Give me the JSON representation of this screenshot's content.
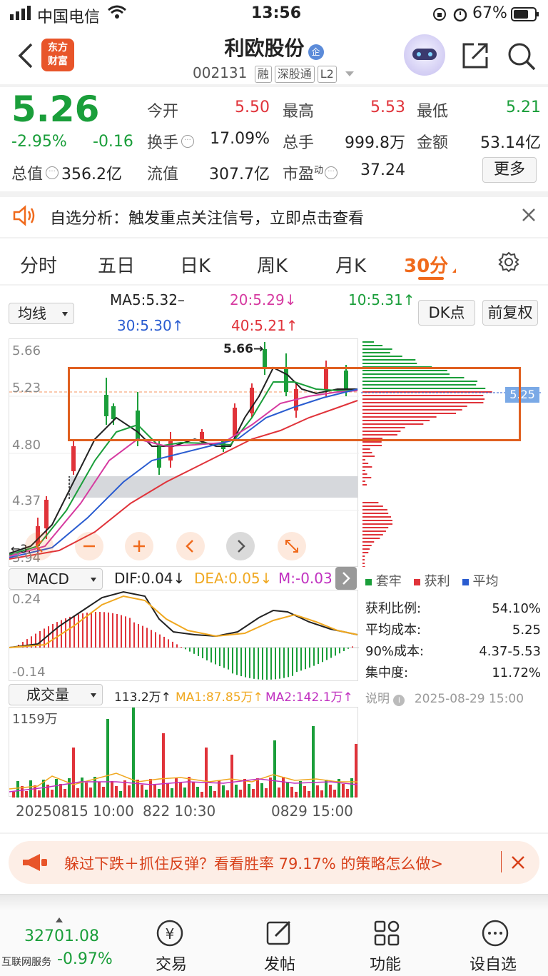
{
  "status_bar": {
    "carrier": "中国电信",
    "time": "13:56",
    "battery": "67%"
  },
  "header": {
    "logo_text": "东方\n财富",
    "title": "利欧股份",
    "title_badge": "企",
    "code": "002131",
    "tags": [
      "融",
      "深股通",
      "L2"
    ]
  },
  "quote": {
    "price": "5.26",
    "change_pct": "-2.95%",
    "change_amt": "-0.16",
    "total_value_label": "总值",
    "total_value": "356.2亿",
    "open_label": "今开",
    "open": "5.50",
    "high_label": "最高",
    "high": "5.53",
    "low_label": "最低",
    "low": "5.21",
    "turnover_label": "换手",
    "turnover": "17.09%",
    "volume_label": "总手",
    "volume": "999.8万",
    "amount_label": "金额",
    "amount": "53.14亿",
    "float_label": "流值",
    "float_value": "307.7亿",
    "pe_label": "市盈",
    "pe_sup": "动",
    "pe": "37.24",
    "more_label": "更多"
  },
  "alert_banner": {
    "text": "自选分析：触发重点关注信号，立即点击查看"
  },
  "period_tabs": [
    {
      "label": "分时",
      "active": false
    },
    {
      "label": "五日",
      "active": false
    },
    {
      "label": "日K",
      "active": false
    },
    {
      "label": "周K",
      "active": false
    },
    {
      "label": "月K",
      "active": false
    },
    {
      "label": "30分",
      "active": true
    }
  ],
  "ma_controls": {
    "selector": "均线",
    "ma5": "MA5:5.32–",
    "ma20": "20:5.29↓",
    "ma10": "10:5.31↑",
    "ma30": "30:5.30↑",
    "ma40": "40:5.21↑",
    "dk_button": "DK点",
    "adjust_button": "前复权"
  },
  "kline": {
    "y_labels": [
      "5.66",
      "5.23",
      "4.80",
      "4.37",
      "3.94"
    ],
    "max_marker": "5.66→",
    "min_marker": "←3.",
    "current_tag": "5.25"
  },
  "macd": {
    "selector": "MACD",
    "dif": "DIF:0.04↓",
    "dea": "DEA:0.05↓",
    "m": "M:-0.03",
    "y_top": "0.24",
    "y_bottom": "-0.14"
  },
  "volume": {
    "selector": "成交量",
    "vol": "113.2万↑",
    "ma1": "MA1:87.85万↑",
    "ma2": "MA2:142.1万↑",
    "y_top": "1159万",
    "x_labels": [
      "20250815 10:00",
      "822 10:30",
      "0829 15:00"
    ]
  },
  "chips": {
    "legend": [
      "套牢",
      "获利",
      "平均"
    ],
    "rows": [
      {
        "label": "获利比例:",
        "value": "54.10%"
      },
      {
        "label": "平均成本:",
        "value": "5.25"
      },
      {
        "label": "90%成本:",
        "value": "4.37-5.53"
      },
      {
        "label": "集中度:",
        "value": "11.72%"
      }
    ],
    "note_label": "说明",
    "note_time": "2025-08-29 15:00"
  },
  "promo": {
    "text": "躲过下跌＋抓住反弹？看看胜率 79.17% 的策略怎么做>"
  },
  "bottom_index": {
    "value": "32701.08",
    "label": "互联网服务",
    "change": "-0.97%"
  },
  "bottom_nav": [
    {
      "label": "交易",
      "icon": "trade-icon"
    },
    {
      "label": "发帖",
      "icon": "post-icon"
    },
    {
      "label": "功能",
      "icon": "function-icon"
    },
    {
      "label": "设自选",
      "icon": "add-watch-icon"
    }
  ],
  "colors": {
    "red": "#e0333a",
    "green": "#1a9e3a",
    "accent": "#f06a1c",
    "blue": "#2a5cd0"
  }
}
